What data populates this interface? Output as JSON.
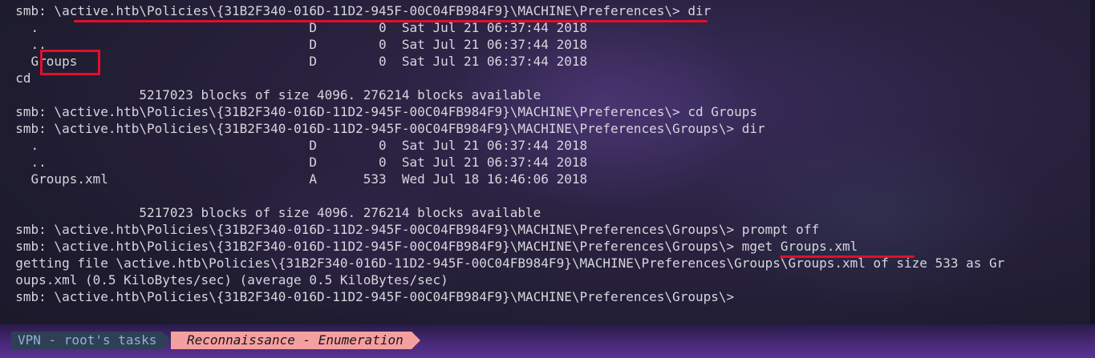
{
  "terminal": {
    "lines": [
      "  smb: \\active.htb\\Policies\\{31B2F340-016D-11D2-945F-00C04FB984F9}\\MACHINE\\Preferences\\> dir",
      "    .                                   D        0  Sat Jul 21 06:37:44 2018",
      "    ..                                  D        0  Sat Jul 21 06:37:44 2018",
      "    Groups                              D        0  Sat Jul 21 06:37:44 2018",
      "  cd",
      "                  5217023 blocks of size 4096. 276214 blocks available",
      "  smb: \\active.htb\\Policies\\{31B2F340-016D-11D2-945F-00C04FB984F9}\\MACHINE\\Preferences\\> cd Groups",
      "  smb: \\active.htb\\Policies\\{31B2F340-016D-11D2-945F-00C04FB984F9}\\MACHINE\\Preferences\\Groups\\> dir",
      "    .                                   D        0  Sat Jul 21 06:37:44 2018",
      "    ..                                  D        0  Sat Jul 21 06:37:44 2018",
      "    Groups.xml                          A      533  Wed Jul 18 16:46:06 2018",
      "",
      "                  5217023 blocks of size 4096. 276214 blocks available",
      "  smb: \\active.htb\\Policies\\{31B2F340-016D-11D2-945F-00C04FB984F9}\\MACHINE\\Preferences\\Groups\\> prompt off",
      "  smb: \\active.htb\\Policies\\{31B2F340-016D-11D2-945F-00C04FB984F9}\\MACHINE\\Preferences\\Groups\\> mget Groups.xml",
      "  getting file \\active.htb\\Policies\\{31B2F340-016D-11D2-945F-00C04FB984F9}\\MACHINE\\Preferences\\Groups\\Groups.xml of size 533 as Gr",
      "  oups.xml (0.5 KiloBytes/sec) (average 0.5 KiloBytes/sec)",
      "  smb: \\active.htb\\Policies\\{31B2F340-016D-11D2-945F-00C04FB984F9}\\MACHINE\\Preferences\\Groups\\>"
    ]
  },
  "statusbar": {
    "vpn_label": "VPN - root's tasks",
    "task_label": "Reconnaissance - Enumeration"
  },
  "colors": {
    "annotation": "#e0102a",
    "text": "#d6d6de",
    "vpn_segment_bg": "#2e3f56",
    "task_segment_bg": "#f5a0a0"
  }
}
